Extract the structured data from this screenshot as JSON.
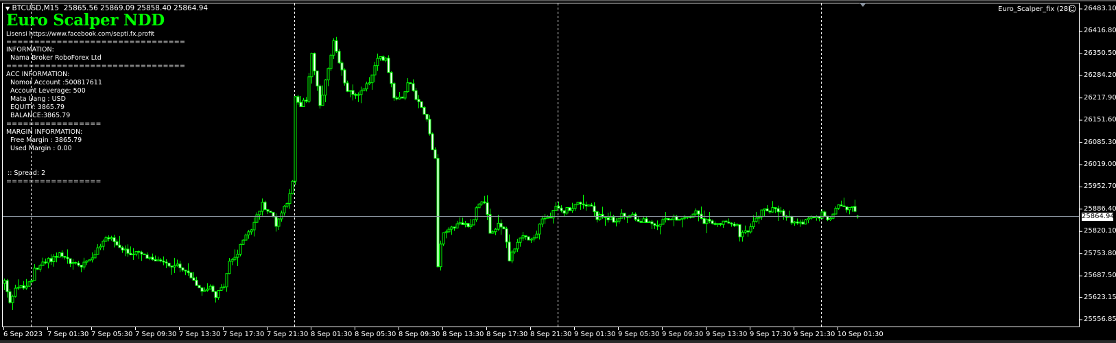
{
  "header": {
    "symbol_line": "BTCUSD,M15  25865.56 25869.09 25858.40 25864.94",
    "expert_label": "Euro_Scalper_fix (28)",
    "expert_status_icon": "smiley-icon",
    "smiley_glyph": "☺",
    "dropdown_glyph": "▼"
  },
  "overlay": {
    "title": "Euro Scalper NDD",
    "license": "Lisensi https://www.facebook.com/septi.fx.profit",
    "sep_long_1": "================================",
    "info_heading": "INFORMATION:",
    "broker": "Nama Broker RoboForex Ltd",
    "sep_long_2": "================================",
    "acc_heading": "ACC INFORMATION:",
    "account_number": "Nomor Account :500817611",
    "leverage": "Account Leverage: 500",
    "currency": "Mata Uang : USD",
    "equity": "EQUITY: 3865.79",
    "balance": "BALANCE:3865.79",
    "sep_short_1": "=================",
    "margin_heading": "MARGIN INFORMATION:",
    "free_margin": "Free Margin : 3865.79",
    "used_margin": "Used Margin : 0.00",
    "spread": ":: Spread: 2",
    "sep_short_2": "================="
  },
  "chart_data": {
    "type": "candlestick",
    "symbol": "BTCUSD",
    "timeframe": "M15",
    "bar_count": 312,
    "colors": {
      "background": "#000000",
      "candle": "#00ff00",
      "bull_body": "#000000",
      "bear_body": "#ffffff",
      "price_line": "#8a94a0",
      "separator": "#ffffff"
    },
    "last_bar": {
      "open": 25865.56,
      "high": 25869.09,
      "low": 25858.4,
      "close": 25864.94
    },
    "current_price": 25864.94,
    "current_price_label": "25864.94",
    "ylim": [
      25556.85,
      26483.1
    ],
    "y_ticks": [
      "26483.10",
      "26416.80",
      "26350.50",
      "26284.20",
      "26217.90",
      "26151.60",
      "26085.30",
      "26019.00",
      "25952.70",
      "25886.40",
      "25820.10",
      "25753.80",
      "25687.50",
      "25623.15",
      "25556.85"
    ],
    "x_ticks": [
      "6 Sep 2023",
      "7 Sep 01:30",
      "7 Sep 05:30",
      "7 Sep 09:30",
      "7 Sep 13:30",
      "7 Sep 17:30",
      "7 Sep 21:30",
      "8 Sep 01:30",
      "8 Sep 05:30",
      "8 Sep 09:30",
      "8 Sep 13:30",
      "8 Sep 17:30",
      "8 Sep 21:30",
      "9 Sep 01:30",
      "9 Sep 05:30",
      "9 Sep 09:30",
      "9 Sep 13:30",
      "9 Sep 17:30",
      "9 Sep 21:30",
      "10 Sep 01:30"
    ],
    "bars_per_x_tick": 16,
    "day_separator_bars": [
      10,
      106,
      202,
      298
    ],
    "close_waypoints": [
      [
        0,
        25671
      ],
      [
        2,
        25604
      ],
      [
        4,
        25657
      ],
      [
        7,
        25651
      ],
      [
        10,
        25671
      ],
      [
        11,
        25712
      ],
      [
        15,
        25727
      ],
      [
        20,
        25753
      ],
      [
        24,
        25727
      ],
      [
        28,
        25718
      ],
      [
        32,
        25747
      ],
      [
        35,
        25774
      ],
      [
        38,
        25810
      ],
      [
        40,
        25788
      ],
      [
        44,
        25759
      ],
      [
        49,
        25753
      ],
      [
        53,
        25739
      ],
      [
        57,
        25727
      ],
      [
        61,
        25718
      ],
      [
        65,
        25712
      ],
      [
        68,
        25686
      ],
      [
        72,
        25645
      ],
      [
        75,
        25657
      ],
      [
        77,
        25630
      ],
      [
        80,
        25657
      ],
      [
        82,
        25727
      ],
      [
        85,
        25753
      ],
      [
        88,
        25815
      ],
      [
        90,
        25829
      ],
      [
        94,
        25902
      ],
      [
        98,
        25862
      ],
      [
        99,
        25841
      ],
      [
        103,
        25911
      ],
      [
        105,
        25964
      ],
      [
        106,
        26217
      ],
      [
        108,
        26189
      ],
      [
        110,
        26217
      ],
      [
        112,
        26352
      ],
      [
        114,
        26250
      ],
      [
        115,
        26189
      ],
      [
        117,
        26264
      ],
      [
        120,
        26381
      ],
      [
        122,
        26320
      ],
      [
        125,
        26244
      ],
      [
        128,
        26230
      ],
      [
        130,
        26238
      ],
      [
        133,
        26264
      ],
      [
        136,
        26332
      ],
      [
        139,
        26340
      ],
      [
        140,
        26299
      ],
      [
        142,
        26223
      ],
      [
        145,
        26217
      ],
      [
        147,
        26270
      ],
      [
        149,
        26238
      ],
      [
        151,
        26203
      ],
      [
        154,
        26162
      ],
      [
        155,
        26107
      ],
      [
        157,
        26033
      ],
      [
        158,
        25718
      ],
      [
        159,
        25780
      ],
      [
        160,
        25815
      ],
      [
        163,
        25835
      ],
      [
        167,
        25841
      ],
      [
        170,
        25835
      ],
      [
        172,
        25890
      ],
      [
        175,
        25917
      ],
      [
        177,
        25808
      ],
      [
        180,
        25841
      ],
      [
        182,
        25829
      ],
      [
        184,
        25739
      ],
      [
        186,
        25774
      ],
      [
        189,
        25808
      ],
      [
        192,
        25788
      ],
      [
        194,
        25808
      ],
      [
        196,
        25862
      ],
      [
        199,
        25862
      ],
      [
        201,
        25890
      ],
      [
        203,
        25876
      ],
      [
        206,
        25890
      ],
      [
        210,
        25906
      ],
      [
        214,
        25892
      ],
      [
        216,
        25862
      ],
      [
        219,
        25866
      ],
      [
        222,
        25851
      ],
      [
        226,
        25872
      ],
      [
        230,
        25855
      ],
      [
        233,
        25851
      ],
      [
        237,
        25831
      ],
      [
        240,
        25853
      ],
      [
        243,
        25862
      ],
      [
        248,
        25859
      ],
      [
        252,
        25876
      ],
      [
        255,
        25849
      ],
      [
        260,
        25845
      ],
      [
        265,
        25841
      ],
      [
        267,
        25835
      ],
      [
        268,
        25808
      ],
      [
        271,
        25819
      ],
      [
        274,
        25855
      ],
      [
        276,
        25880
      ],
      [
        280,
        25886
      ],
      [
        283,
        25872
      ],
      [
        286,
        25855
      ],
      [
        290,
        25847
      ],
      [
        293,
        25855
      ],
      [
        296,
        25859
      ],
      [
        298,
        25872
      ],
      [
        301,
        25855
      ],
      [
        303,
        25892
      ],
      [
        305,
        25898
      ],
      [
        307,
        25890
      ],
      [
        309,
        25886
      ],
      [
        311,
        25864.94
      ]
    ]
  }
}
